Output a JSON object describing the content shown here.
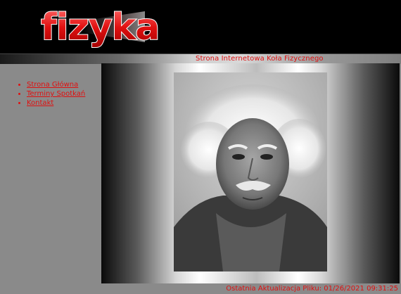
{
  "header": {
    "logo_text": "fizyka"
  },
  "subtitle": "Strona Internetowa Koła Fizycznego",
  "nav": {
    "items": [
      {
        "label": "Strona Główna"
      },
      {
        "label": "Terminy Spotkań"
      },
      {
        "label": "Kontakt"
      }
    ]
  },
  "footer": {
    "last_update": "Ostatnia Aktualizacja Pliku: 01/26/2021 09:31:25"
  },
  "colors": {
    "accent": "#e01010",
    "header_bg": "#000000",
    "page_bg": "#8a8a8a"
  }
}
